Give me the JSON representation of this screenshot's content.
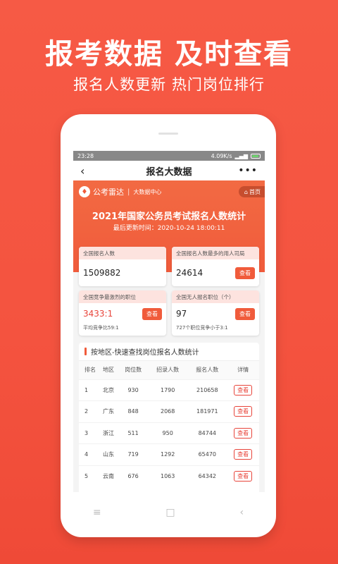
{
  "promo": {
    "title": "报考数据  及时查看",
    "subtitle": "报名人数更新  热门岗位排行"
  },
  "status_bar": {
    "time": "23:28",
    "speed": "4.09K/s",
    "battery_icon": "battery-icon"
  },
  "navbar": {
    "back_icon": "‹",
    "title": "报名大数据",
    "more_icon": "•••"
  },
  "hero": {
    "brand_logo": "♦",
    "brand_name": "公考雷达",
    "brand_center": "大数据中心",
    "home_label": "首页",
    "title": "2021年国家公务员考试报名人数统计",
    "updated": "最后更新时间：2020-10-24 18:00:11"
  },
  "cards": [
    {
      "label": "全国报名人数",
      "value": "1509882",
      "button": "",
      "note": ""
    },
    {
      "label": "全国报名人数最多的用人司局",
      "value": "24614",
      "button": "查看",
      "note": ""
    },
    {
      "label": "全国竞争最激烈的职位",
      "value": "3433:1",
      "button": "查看",
      "note": "平均竞争比59:1"
    },
    {
      "label": "全国无人报名职位（个）",
      "value": "97",
      "button": "查看",
      "note": "727个职位竞争小于3:1"
    }
  ],
  "region": {
    "title": "按地区-快速查找岗位报名人数统计",
    "columns": [
      "排名",
      "地区",
      "岗位数",
      "招录人数",
      "报名人数",
      "详情"
    ],
    "rows": [
      {
        "rank": "1",
        "area": "北京",
        "posts": "930",
        "hires": "1790",
        "applicants": "210658",
        "action": "查看"
      },
      {
        "rank": "2",
        "area": "广东",
        "posts": "848",
        "hires": "2068",
        "applicants": "181971",
        "action": "查看"
      },
      {
        "rank": "3",
        "area": "浙江",
        "posts": "511",
        "hires": "950",
        "applicants": "84744",
        "action": "查看"
      },
      {
        "rank": "4",
        "area": "山东",
        "posts": "719",
        "hires": "1292",
        "applicants": "65470",
        "action": "查看"
      },
      {
        "rank": "5",
        "area": "云南",
        "posts": "676",
        "hires": "1063",
        "applicants": "64342",
        "action": "查看"
      }
    ]
  },
  "phone_nav": {
    "menu": "≡",
    "home": "□",
    "back": "‹"
  },
  "colors": {
    "accent": "#f05b3b",
    "background": "#f4533f"
  }
}
